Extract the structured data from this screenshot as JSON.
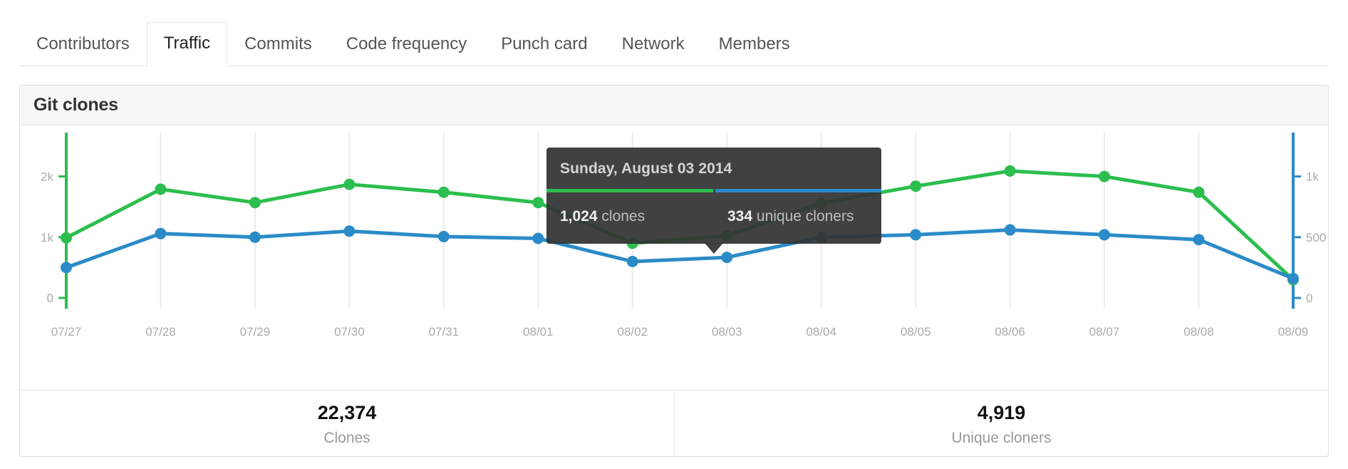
{
  "tabnav": {
    "tabs": [
      {
        "label": "Contributors",
        "selected": false
      },
      {
        "label": "Traffic",
        "selected": true
      },
      {
        "label": "Commits",
        "selected": false
      },
      {
        "label": "Code frequency",
        "selected": false
      },
      {
        "label": "Punch card",
        "selected": false
      },
      {
        "label": "Network",
        "selected": false
      },
      {
        "label": "Members",
        "selected": false
      }
    ]
  },
  "card": {
    "title": "Git clones"
  },
  "tooltip": {
    "date": "Sunday, August 03 2014",
    "clones_value": "1,024",
    "clones_label": "clones",
    "uniques_value": "334",
    "uniques_label": "unique cloners"
  },
  "totals": [
    {
      "number": "22,374",
      "label": "Clones"
    },
    {
      "number": "4,919",
      "label": "Unique cloners"
    }
  ],
  "colors": {
    "clones_green": "#2cbe4e",
    "uniques_blue": "#2b8bc8",
    "axis_text": "#aaaaaa",
    "gridline": "#ebebeb",
    "card_border": "#e0e0e0",
    "header_bg": "#f7f7f7",
    "tooltip_bg": "#333333"
  },
  "chart_data": {
    "type": "line",
    "title": "Git clones",
    "xlabel": "",
    "ylabel": "",
    "grid": true,
    "legend_position": "none",
    "x": [
      "07/27",
      "07/28",
      "07/29",
      "07/30",
      "07/31",
      "08/01",
      "08/02",
      "08/03",
      "08/04",
      "08/05",
      "08/06",
      "08/07",
      "08/08",
      "08/09"
    ],
    "x_tick_labels": [
      "07/27",
      "07/28",
      "07/29",
      "07/30",
      "07/31",
      "08/01",
      "08/02",
      "08/03",
      "08/04",
      "08/05",
      "08/06",
      "08/07",
      "08/08",
      "08/09"
    ],
    "left_axis": {
      "name": "clones",
      "color": "#2cbe4e",
      "ticks": [
        0,
        1000,
        2000
      ],
      "tick_labels": [
        "0",
        "1k",
        "2k"
      ],
      "ylim": [
        0,
        2300
      ]
    },
    "right_axis": {
      "name": "unique cloners",
      "color": "#2b8bc8",
      "ticks": [
        0,
        500,
        1000
      ],
      "tick_labels": [
        "0",
        "500",
        "1k"
      ],
      "ylim": [
        0,
        1150
      ]
    },
    "series": [
      {
        "name": "clones",
        "axis": "left",
        "color": "#2cbe4e",
        "values": [
          990,
          1790,
          1570,
          1870,
          1740,
          1570,
          900,
          1024,
          1560,
          1840,
          2090,
          2000,
          1740,
          300
        ]
      },
      {
        "name": "unique cloners",
        "axis": "right",
        "color": "#2b8bc8",
        "values": [
          250,
          530,
          500,
          550,
          505,
          490,
          300,
          334,
          500,
          520,
          560,
          520,
          480,
          160
        ]
      }
    ],
    "highlighted_point": {
      "x": "08/03",
      "date_label": "Sunday, August 03 2014",
      "clones": 1024,
      "unique_cloners": 334
    },
    "totals": {
      "clones": 22374,
      "unique_cloners": 4919
    }
  }
}
